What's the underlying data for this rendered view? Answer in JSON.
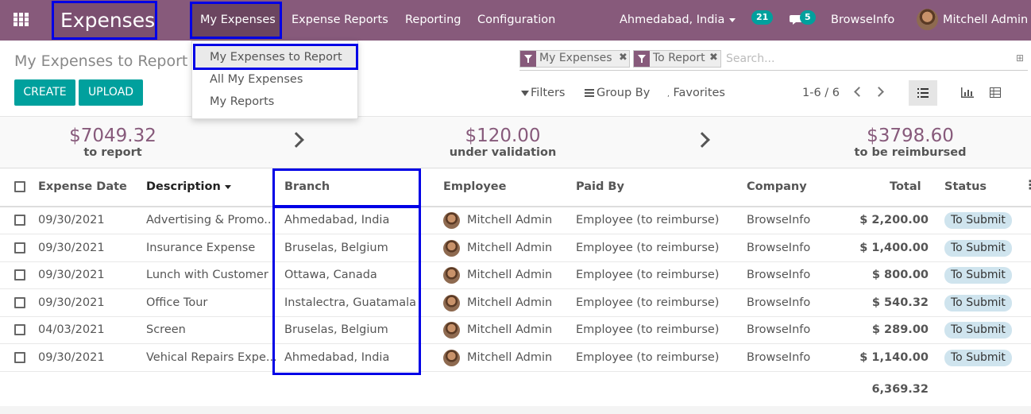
{
  "navbar": {
    "app_title": "Expenses",
    "menu": [
      "My Expenses",
      "Expense Reports",
      "Reporting",
      "Configuration"
    ],
    "branch": "Ahmedabad, India",
    "activity_count": "21",
    "message_count": "5",
    "company": "BrowseInfo",
    "user": "Mitchell Admin",
    "accent_color": "#875a7b"
  },
  "dropdown": {
    "items": [
      "My Expenses to Report",
      "All My Expenses",
      "My Reports"
    ]
  },
  "control_panel": {
    "breadcrumb": "My Expenses to Report",
    "create_label": "CREATE",
    "upload_label": "UPLOAD",
    "facets": [
      "My Expenses",
      "To Report"
    ],
    "search_placeholder": "Search...",
    "filters_label": "Filters",
    "group_by_label": "Group By",
    "favorites_label": "Favorites",
    "pager": "1-6 / 6"
  },
  "summary": [
    {
      "amount": "$7049.32",
      "label": "to report"
    },
    {
      "amount": "$120.00",
      "label": "under validation"
    },
    {
      "amount": "$3798.60",
      "label": "to be reimbursed"
    }
  ],
  "table": {
    "columns": [
      "Expense Date",
      "Description",
      "Branch",
      "Employee",
      "Paid By",
      "Company",
      "Total",
      "Status"
    ],
    "rows": [
      {
        "date": "09/30/2021",
        "description": "Advertising & Promo...",
        "branch": "Ahmedabad, India",
        "employee": "Mitchell Admin",
        "paid_by": "Employee (to reimburse)",
        "company": "BrowseInfo",
        "total": "$ 2,200.00",
        "status": "To Submit"
      },
      {
        "date": "09/30/2021",
        "description": "Insurance Expense",
        "branch": "Bruselas, Belgium",
        "employee": "Mitchell Admin",
        "paid_by": "Employee (to reimburse)",
        "company": "BrowseInfo",
        "total": "$ 1,400.00",
        "status": "To Submit"
      },
      {
        "date": "09/30/2021",
        "description": "Lunch with Customer",
        "branch": "Ottawa, Canada",
        "employee": "Mitchell Admin",
        "paid_by": "Employee (to reimburse)",
        "company": "BrowseInfo",
        "total": "$ 800.00",
        "status": "To Submit"
      },
      {
        "date": "09/30/2021",
        "description": "Office Tour",
        "branch": "Instalectra, Guatamala",
        "employee": "Mitchell Admin",
        "paid_by": "Employee (to reimburse)",
        "company": "BrowseInfo",
        "total": "$ 540.32",
        "status": "To Submit"
      },
      {
        "date": "04/03/2021",
        "description": "Screen",
        "branch": "Bruselas, Belgium",
        "employee": "Mitchell Admin",
        "paid_by": "Employee (to reimburse)",
        "company": "BrowseInfo",
        "total": "$ 289.00",
        "status": "To Submit"
      },
      {
        "date": "09/30/2021",
        "description": "Vehical Repairs Expe...",
        "branch": "Ahmedabad, India",
        "employee": "Mitchell Admin",
        "paid_by": "Employee (to reimburse)",
        "company": "BrowseInfo",
        "total": "$ 1,140.00",
        "status": "To Submit"
      }
    ],
    "grand_total": "6,369.32"
  }
}
